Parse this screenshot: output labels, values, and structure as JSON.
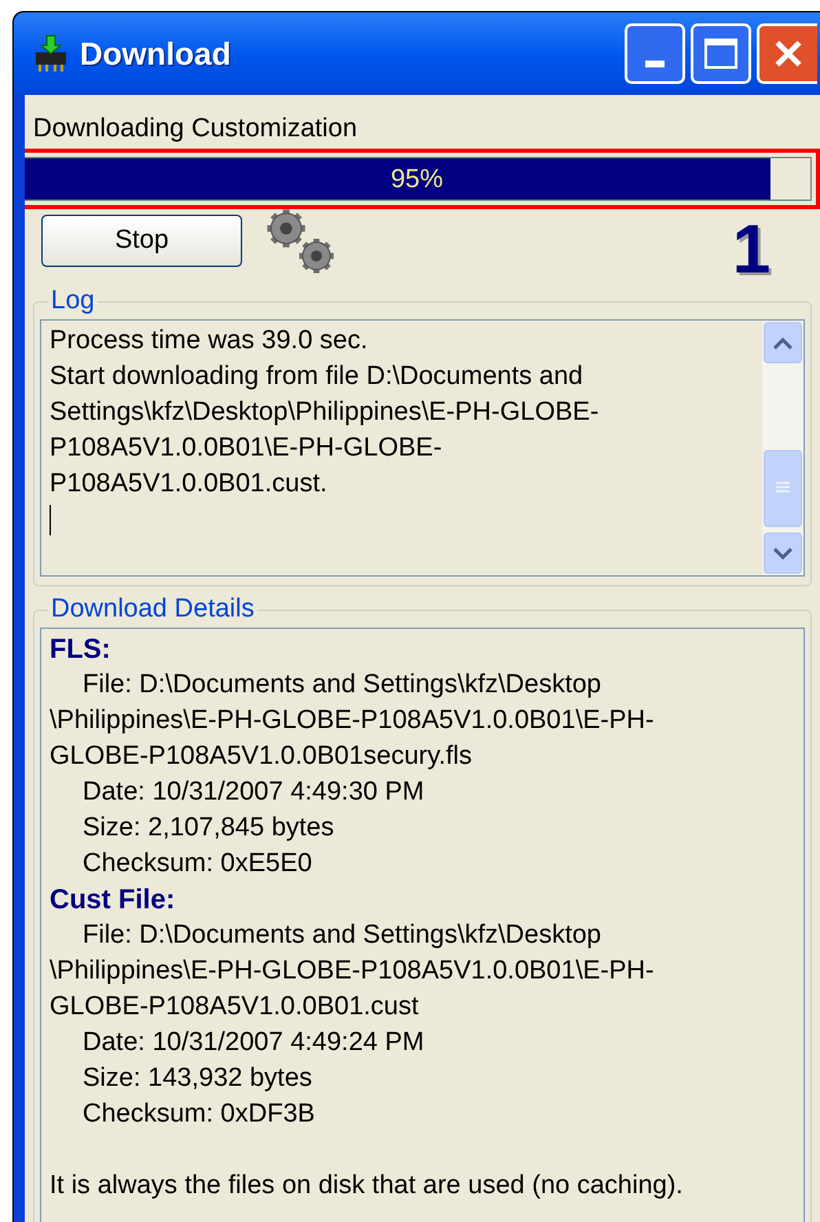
{
  "window": {
    "title": "Download"
  },
  "status_label": "Downloading Customization",
  "progress": {
    "level": 0.95,
    "text": "95%",
    "highlighted": true
  },
  "stop_button": "Stop",
  "counter": "1",
  "log": {
    "title": "Log",
    "lines": [
      "Process time was 39.0 sec.",
      "Start downloading from file D:\\Documents and",
      "Settings\\kfz\\Desktop\\Philippines\\E-PH-GLOBE-",
      "P108A5V1.0.0B01\\E-PH-GLOBE-",
      "P108A5V1.0.0B01.cust."
    ]
  },
  "details": {
    "title": "Download Details",
    "entries": [
      {
        "kind": "heading",
        "lines": [
          "FLS:"
        ]
      },
      {
        "kind": "field",
        "lines": [
          "File: D:\\Documents and Settings\\kfz\\Desktop",
          "\\Philippines\\E-PH-GLOBE-P108A5V1.0.0B01\\E-PH-",
          "GLOBE-P108A5V1.0.0B01secury.fls"
        ]
      },
      {
        "kind": "field",
        "lines": [
          "Date: 10/31/2007 4:49:30 PM"
        ]
      },
      {
        "kind": "field",
        "lines": [
          "Size: 2,107,845 bytes"
        ]
      },
      {
        "kind": "field",
        "lines": [
          "Checksum: 0xE5E0"
        ]
      },
      {
        "kind": "heading",
        "lines": [
          "Cust File:"
        ]
      },
      {
        "kind": "field",
        "lines": [
          "File: D:\\Documents and Settings\\kfz\\Desktop",
          "\\Philippines\\E-PH-GLOBE-P108A5V1.0.0B01\\E-PH-",
          "GLOBE-P108A5V1.0.0B01.cust"
        ]
      },
      {
        "kind": "field",
        "lines": [
          "Date: 10/31/2007 4:49:24 PM"
        ]
      },
      {
        "kind": "field",
        "lines": [
          "Size: 143,932 bytes"
        ]
      },
      {
        "kind": "field",
        "lines": [
          "Checksum: 0xDF3B"
        ]
      },
      {
        "kind": "gap"
      },
      {
        "kind": "note",
        "lines": [
          "It is always the files on disk that are used (no caching)."
        ]
      }
    ]
  }
}
